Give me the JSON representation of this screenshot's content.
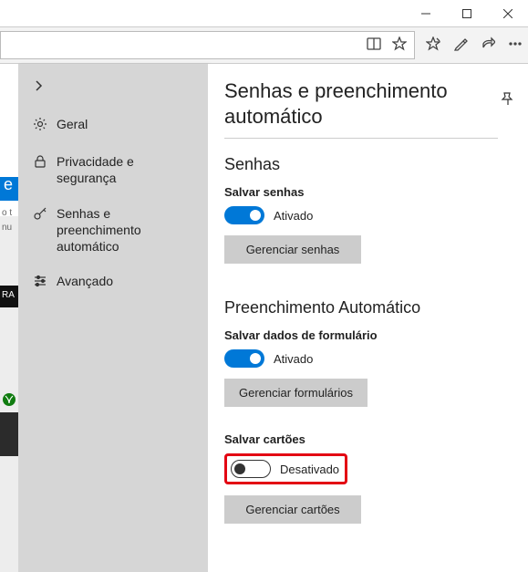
{
  "titlebar": {},
  "sidebar": {
    "items": [
      {
        "label": "Geral"
      },
      {
        "label": "Privacidade e segurança"
      },
      {
        "label": "Senhas e preenchimento automático"
      },
      {
        "label": "Avançado"
      }
    ]
  },
  "panel": {
    "title": "Senhas e preenchimento automático",
    "section_passwords": {
      "heading": "Senhas",
      "save_label": "Salvar senhas",
      "toggle_state": "Ativado",
      "manage_btn": "Gerenciar senhas"
    },
    "section_autofill": {
      "heading": "Preenchimento Automático",
      "form_label": "Salvar dados de formulário",
      "form_toggle_state": "Ativado",
      "form_manage_btn": "Gerenciar formulários",
      "cards_label": "Salvar cartões",
      "cards_toggle_state": "Desativado",
      "cards_manage_btn": "Gerenciar cartões"
    }
  },
  "bg": {
    "e": "e",
    "t1": "o t",
    "t2": "nu",
    "ra": "RA"
  }
}
